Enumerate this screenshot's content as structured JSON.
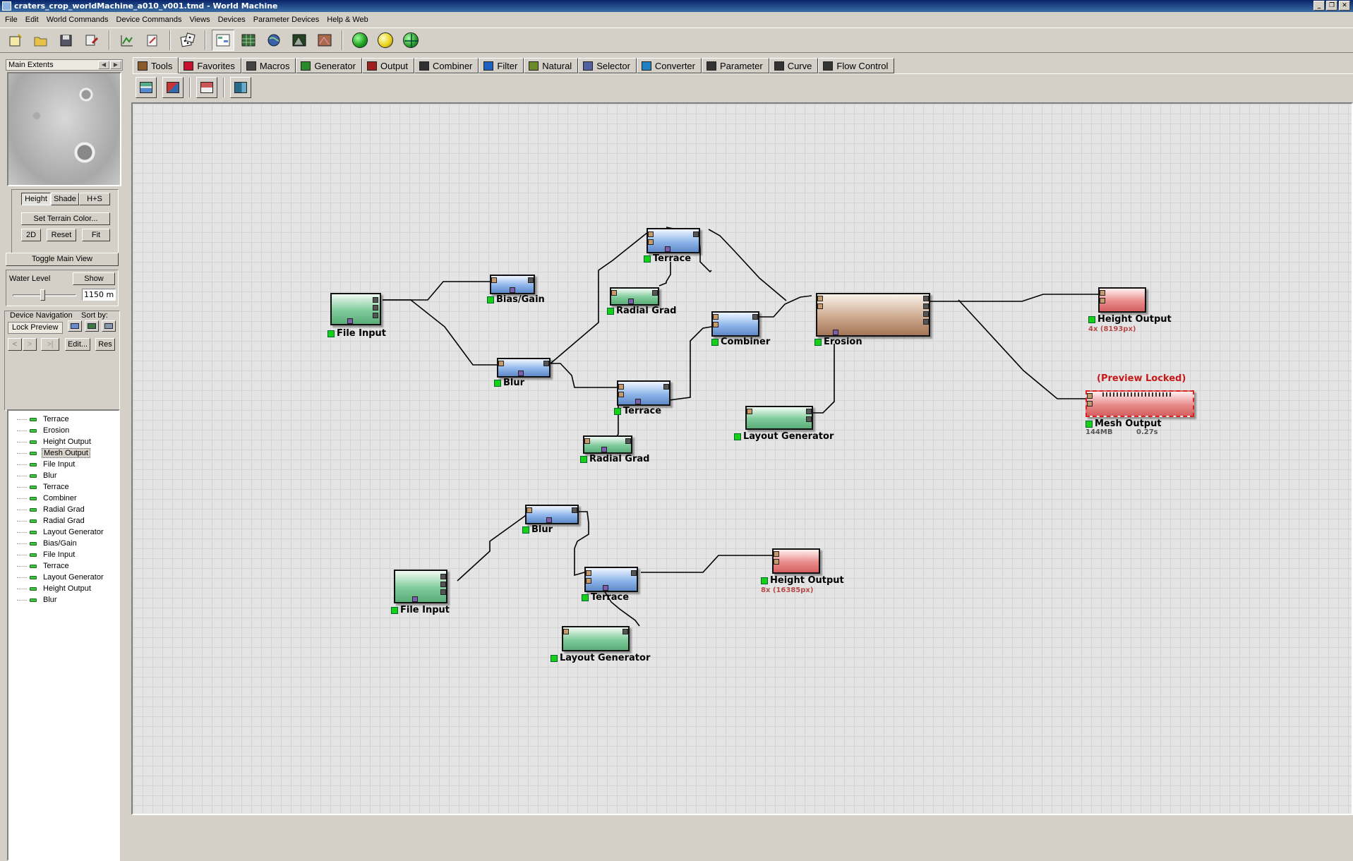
{
  "window": {
    "title": "craters_crop_worldMachine_a010_v001.tmd - World Machine"
  },
  "menu": [
    "File",
    "Edit",
    "World Commands",
    "Device Commands",
    "Views",
    "Devices",
    "Parameter Devices",
    "Help & Web"
  ],
  "toolbar": {
    "icons": [
      "new-file-icon",
      "open-folder-icon",
      "save-icon",
      "save-as-icon",
      "graph-icon",
      "edit-icon",
      "dice-icon",
      "layout-view-icon",
      "grid-view-icon",
      "globe-icon",
      "terrain-icon",
      "texture-icon",
      "green-ball-icon",
      "yellow-ball-icon",
      "green-globe-icon"
    ]
  },
  "preview": {
    "header": "Main Extents",
    "mode_buttons": [
      "Height",
      "Shade",
      "H+S"
    ],
    "set_terrain_color": "Set Terrain Color...",
    "view_buttons": [
      "2D",
      "Reset",
      "Fit"
    ],
    "toggle_main_view": "Toggle Main View",
    "water_level_label": "Water Level",
    "show_button": "Show",
    "water_level_value": "1150 m",
    "water_level_fraction": 0.45
  },
  "navigation": {
    "title": "Device Navigation",
    "sort_label": "Sort by:",
    "lock_preview": "Lock Preview",
    "nav_buttons": [
      "<",
      ">",
      ">|"
    ],
    "edit_button": "Edit...",
    "res_button": "Res",
    "devices": [
      "Terrace",
      "Erosion",
      "Height Output",
      "Mesh Output",
      "File Input",
      "Blur",
      "Terrace",
      "Combiner",
      "Radial Grad",
      "Radial Grad",
      "Layout Generator",
      "Bias/Gain",
      "File Input",
      "Terrace",
      "Layout Generator",
      "Height Output",
      "Blur"
    ],
    "selected_index": 3
  },
  "tabs": [
    {
      "label": "Tools",
      "icon": "tools-icon",
      "active": true
    },
    {
      "label": "Favorites",
      "icon": "heart-icon"
    },
    {
      "label": "Macros",
      "icon": "macros-icon"
    },
    {
      "label": "Generator",
      "icon": "generator-icon"
    },
    {
      "label": "Output",
      "icon": "output-icon"
    },
    {
      "label": "Combiner",
      "icon": "combiner-icon"
    },
    {
      "label": "Filter",
      "icon": "filter-icon"
    },
    {
      "label": "Natural",
      "icon": "natural-icon"
    },
    {
      "label": "Selector",
      "icon": "selector-icon"
    },
    {
      "label": "Converter",
      "icon": "converter-icon"
    },
    {
      "label": "Parameter",
      "icon": "parameter-icon"
    },
    {
      "label": "Curve",
      "icon": "curve-icon"
    },
    {
      "label": "Flow Control",
      "icon": "flow-control-icon"
    }
  ],
  "tool_buttons": [
    "group-tool-icon",
    "copy-tool-icon",
    "export-tool-icon",
    "layout-tool-icon"
  ],
  "graph": {
    "nodes": {
      "file_input_1": "File Input",
      "bias_gain": "Bias/Gain",
      "blur_1": "Blur",
      "terrace_1": "Terrace",
      "radial_grad_1": "Radial Grad",
      "combiner": "Combiner",
      "terrace_2": "Terrace",
      "radial_grad_2": "Radial Grad",
      "erosion": "Erosion",
      "layout_gen_1": "Layout Generator",
      "height_output_1": "Height Output",
      "height_output_1_res": "4x (8193px)",
      "mesh_output": "Mesh Output",
      "mesh_output_locked": "(Preview Locked)",
      "mesh_output_mem": "144MB",
      "mesh_output_time": "0.27s",
      "blur_2": "Blur",
      "file_input_2": "File Input",
      "terrace_3": "Terrace",
      "height_output_2": "Height Output",
      "height_output_2_res": "8x (16385px)",
      "layout_gen_2": "Layout Generator"
    }
  },
  "colors": {
    "generator": "#7fcb9b",
    "filter": "#8fb6ea",
    "natural": "#c9a487",
    "output": "#e98c8c",
    "titlebar": "#0a246a",
    "status_led": "#16d016"
  }
}
